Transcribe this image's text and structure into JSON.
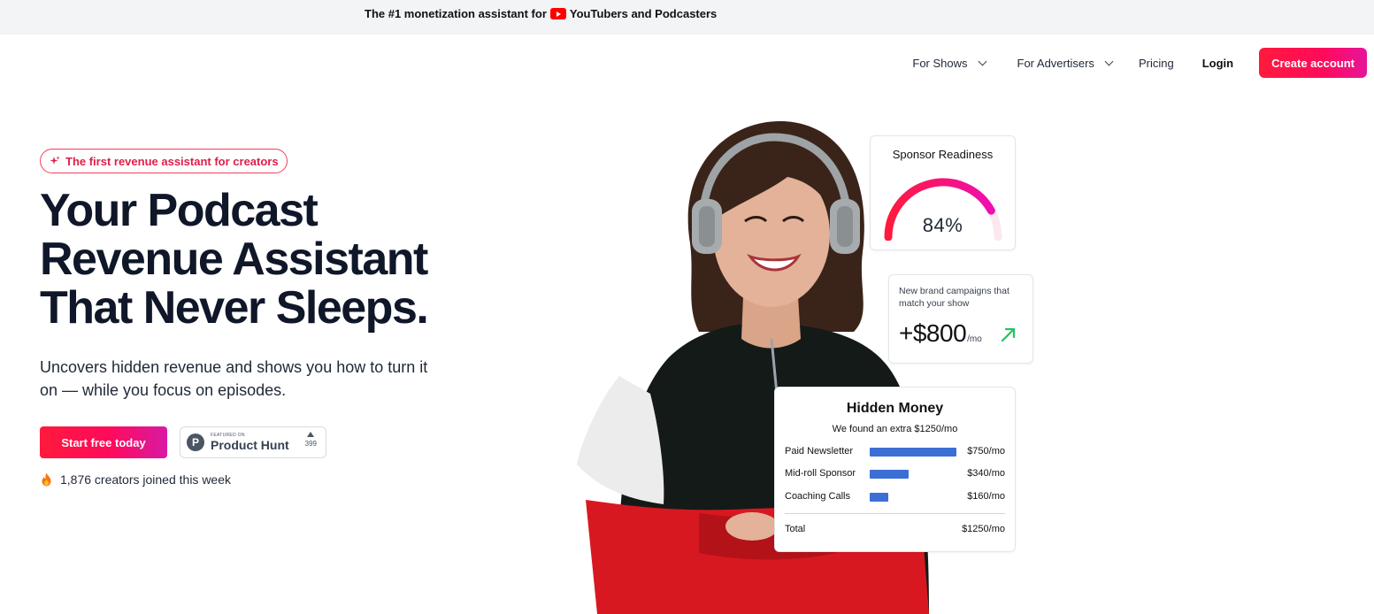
{
  "announcement": {
    "prefix": "The #1 monetization assistant for",
    "suffix": "YouTubers and Podcasters"
  },
  "nav": {
    "items": [
      {
        "label": "For Shows"
      },
      {
        "label": "For Advertisers"
      },
      {
        "label": "Pricing"
      },
      {
        "label": "Login"
      }
    ],
    "cta": "Create account"
  },
  "hero": {
    "badge": "The first revenue assistant for creators",
    "title_lines": [
      "Your Podcast",
      "Revenue Assistant",
      "That Never Sleeps."
    ],
    "subtitle": "Uncovers hidden revenue and shows you how to turn it on — while you focus on episodes.",
    "cta": "Start free today",
    "product_hunt": {
      "featured": "FEATURED ON",
      "name": "Product Hunt",
      "votes": "399"
    },
    "joined": "1,876 creators joined this week"
  },
  "sponsor_card": {
    "title": "Sponsor Readiness",
    "value": "84%",
    "fraction": 0.84
  },
  "brand_card": {
    "title": "New brand campaigns that match your show",
    "amount": "+$800",
    "unit": "/mo"
  },
  "money_card": {
    "title": "Hidden Money",
    "subtitle": "We found an extra $1250/mo",
    "rows": [
      {
        "label": "Paid Newsletter",
        "amount": "$750/mo",
        "value": 750
      },
      {
        "label": "Mid-roll Sponsor",
        "amount": "$340/mo",
        "value": 340
      },
      {
        "label": "Coaching Calls",
        "amount": "$160/mo",
        "value": 160
      }
    ],
    "total_label": "Total",
    "total_amount": "$1250/mo"
  },
  "colors": {
    "brand_red": "#ff0a3c",
    "brand_pink": "#e6159a",
    "bar_blue": "#3b6fd4",
    "arrow_green": "#22c55e"
  }
}
